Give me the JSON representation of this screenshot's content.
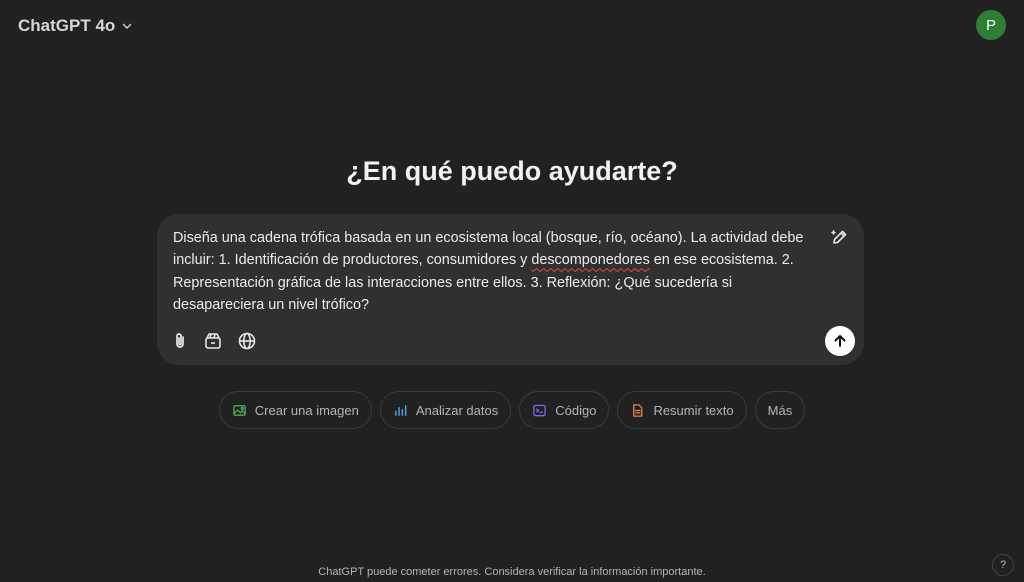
{
  "header": {
    "model_name": "ChatGPT 4o",
    "avatar_initial": "P",
    "avatar_color": "#2e7d32"
  },
  "main": {
    "headline": "¿En qué puedo ayudarte?"
  },
  "composer": {
    "text_before": "Diseña una cadena trófica basada en un ecosistema local (bosque, río, océano). La actividad debe incluir: 1. Identificación de productores, consumidores y ",
    "text_misspelled": "descomponedores",
    "text_after": " en ese ecosistema. 2. Representación gráfica de las interacciones entre ellos. 3. Reflexión: ¿Qué sucedería si desapareciera un nivel trófico?",
    "icons": [
      "edit-icon",
      "paperclip-icon",
      "tools-icon",
      "globe-icon",
      "arrow-up-icon"
    ]
  },
  "chips": [
    {
      "label": "Crear una imagen",
      "icon": "image-icon",
      "color": "#4caf50"
    },
    {
      "label": "Analizar datos",
      "icon": "bar-chart-icon",
      "color": "#4fa3e0"
    },
    {
      "label": "Código",
      "icon": "terminal-icon",
      "color": "#7b6cf0"
    },
    {
      "label": "Resumir texto",
      "icon": "document-icon",
      "color": "#e8844a"
    },
    {
      "label": "Más",
      "icon": "",
      "color": ""
    }
  ],
  "footer": {
    "disclaimer": "ChatGPT puede cometer errores. Considera verificar la información importante.",
    "help_label": "?"
  }
}
